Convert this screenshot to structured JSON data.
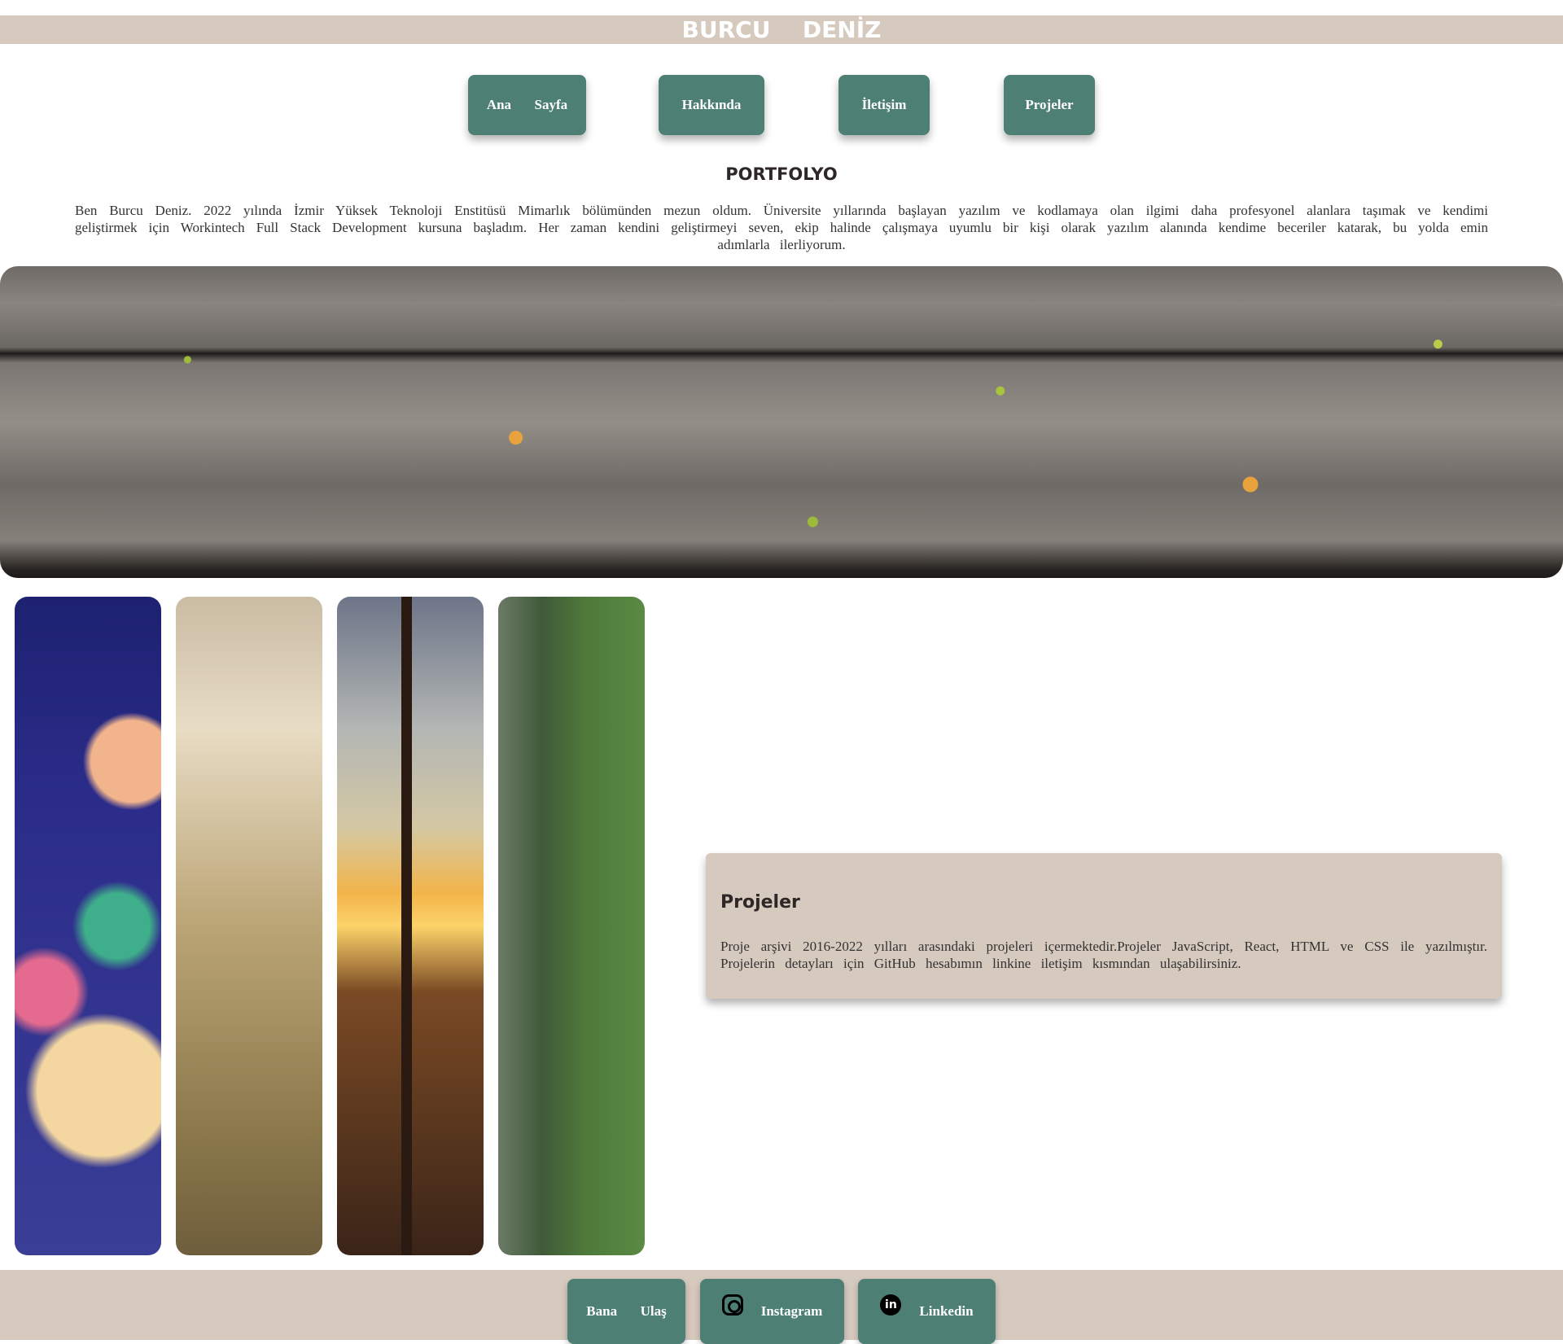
{
  "header": {
    "title": "BURCU  DENİZ"
  },
  "nav": [
    {
      "label": "Ana  Sayfa"
    },
    {
      "label": "Hakkında"
    },
    {
      "label": "İletişim"
    },
    {
      "label": "Projeler"
    }
  ],
  "main": {
    "title": "PORTFOLYO",
    "intro": "Ben Burcu Deniz. 2022 yılında İzmir Yüksek Teknoloji Enstitüsü Mimarlık bölümünden mezun oldum. Üniversite yıllarında başlayan yazılım ve kodlamaya olan ilgimi daha profesyonel alanlara taşımak ve kendimi geliştirmek için Workintech Full Stack Development kursuna başladım. Her zaman kendini geliştirmeyi seven, ekip halinde çalışmaya uyumlu bir kişi olarak yazılım alanında kendime beceriler katarak, bu yolda emin adımlarla ilerliyorum."
  },
  "projects": {
    "title": "Projeler",
    "text": "Proje arşivi 2016-2022 yılları arasındaki projeleri içermektedir.Projeler JavaScript, React, HTML ve CSS ile yazılmıştır. Projelerin detayları için GitHub hesabımın linkine iletişim kısmından ulaşabilirsiniz."
  },
  "footer": {
    "buttons": [
      {
        "label": "Bana  Ulaş"
      },
      {
        "label": "Instagram",
        "icon": "instagram-icon"
      },
      {
        "label": "Linkedin",
        "icon": "linkedin-icon"
      }
    ]
  },
  "colors": {
    "accent": "#4d7f75",
    "beige": "#d6c9bd"
  }
}
